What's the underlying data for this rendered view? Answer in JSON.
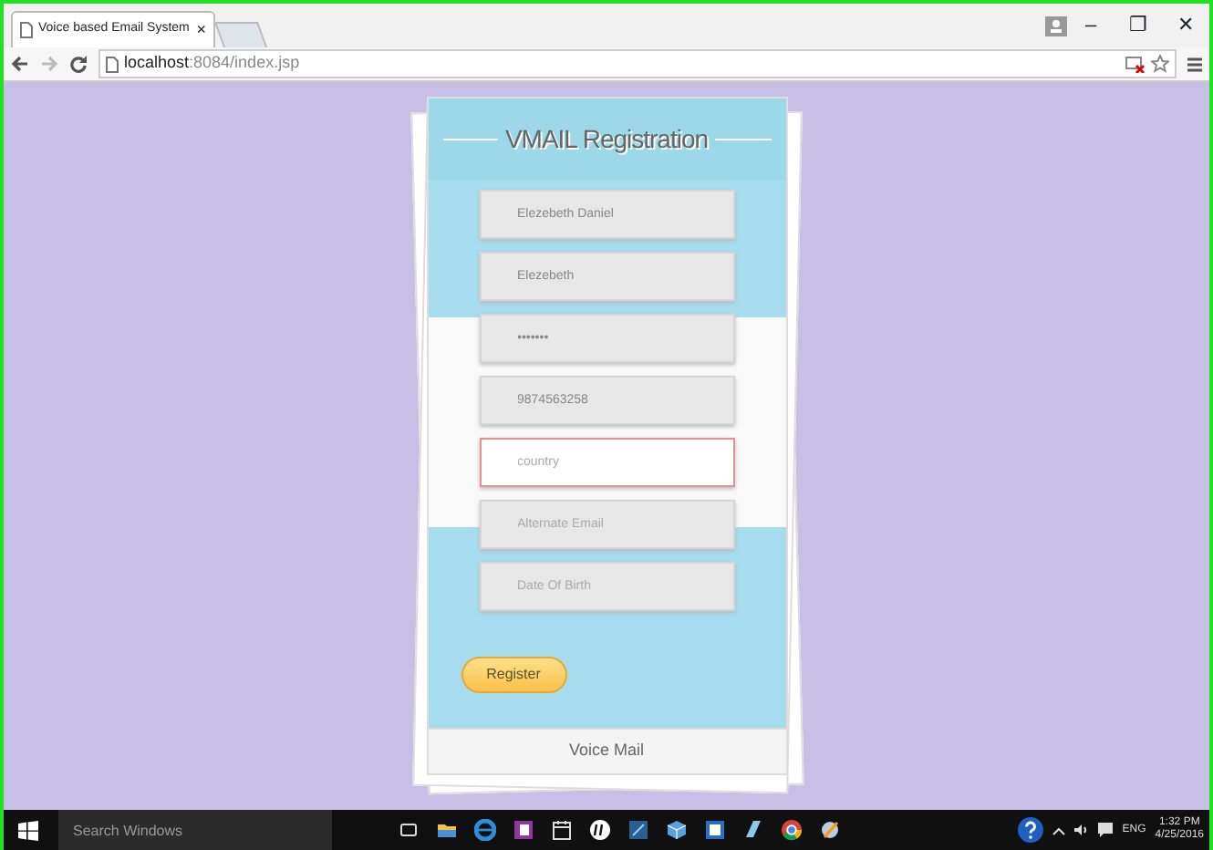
{
  "browser": {
    "tab_title": "Voice based Email System",
    "tab_close": "×",
    "url_host": "localhost",
    "url_path": ":8084/index.jsp",
    "window_controls": [
      "–",
      "❐",
      "✕"
    ]
  },
  "form": {
    "title": "VMAIL Registration",
    "fields": [
      {
        "value": "Elezebeth Daniel",
        "focused": false
      },
      {
        "value": "Elezebeth",
        "focused": false
      },
      {
        "value": "•••••••",
        "focused": false
      },
      {
        "value": "9874563258",
        "focused": false
      },
      {
        "placeholder": "country",
        "focused": true
      },
      {
        "placeholder": "Alternate Email",
        "focused": false
      },
      {
        "placeholder": "Date Of Birth",
        "focused": false
      }
    ],
    "submit": "Register",
    "footer": "Voice Mail"
  },
  "taskbar": {
    "search_placeholder": "Search Windows",
    "language": "ENG",
    "time": "1:32 PM",
    "date": "4/25/2016"
  }
}
